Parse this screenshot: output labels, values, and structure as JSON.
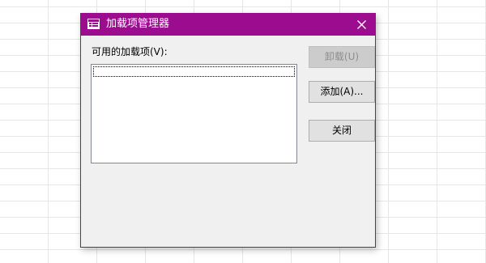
{
  "dialog": {
    "title": "加载项管理器",
    "icon": "dialog-window-icon",
    "list_label": "可用的加载项(V):",
    "items": [],
    "buttons": {
      "unload": "卸载(U)",
      "add": "添加(A)...",
      "close": "关闭"
    },
    "accent_color": "#9b0c8e"
  }
}
